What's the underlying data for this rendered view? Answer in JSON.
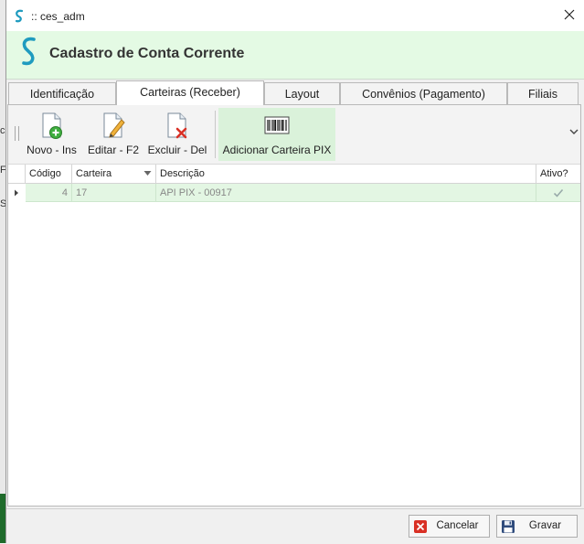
{
  "window": {
    "title": ":: ces_adm"
  },
  "header": {
    "title": "Cadastro de Conta Corrente"
  },
  "tabs": [
    {
      "label": "Identificação",
      "active": false
    },
    {
      "label": "Carteiras (Receber)",
      "active": true
    },
    {
      "label": "Layout",
      "active": false
    },
    {
      "label": "Convênios (Pagamento)",
      "active": false
    },
    {
      "label": "Filiais",
      "active": false
    }
  ],
  "toolbar": {
    "new_label": "Novo - Ins",
    "edit_label": "Editar - F2",
    "delete_label": "Excluir - Del",
    "add_pix_label": "Adicionar Carteira PIX"
  },
  "grid": {
    "columns": [
      "Código",
      "Carteira",
      "Descrição",
      "Ativo?"
    ],
    "rows": [
      {
        "codigo": "4",
        "carteira": "17",
        "descricao": "API PIX - 00917",
        "ativo": true
      }
    ]
  },
  "footer": {
    "cancel_label": "Cancelar",
    "save_label": "Gravar"
  },
  "background_fragments": [
    "c",
    "F",
    "Si"
  ],
  "colors": {
    "header_bg": "#e4fae4",
    "accent": "#1f9bbf",
    "row_selected": "#e3f6e3"
  }
}
